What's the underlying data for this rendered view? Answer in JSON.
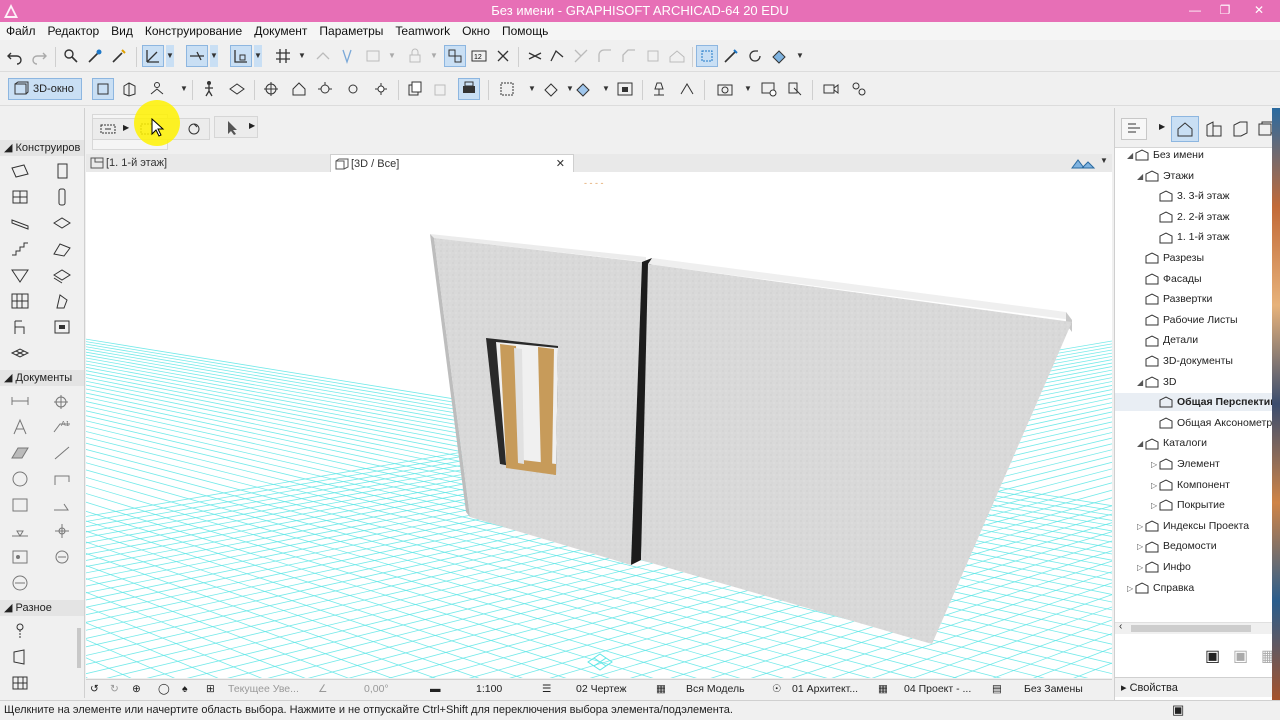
{
  "window": {
    "title": "Без имени - GRAPHISOFT ARCHICAD-64 20 EDU",
    "controls": [
      "minimize-icon",
      "restore-icon",
      "close-icon"
    ]
  },
  "menu": [
    "Файл",
    "Редактор",
    "Вид",
    "Конструирование",
    "Документ",
    "Параметры",
    "Teamwork",
    "Окно",
    "Помощь"
  ],
  "toolbar2": {
    "view_button_label": "3D-окно"
  },
  "toolbox": {
    "sections": [
      {
        "label": "Конструиров"
      },
      {
        "label": "Документы"
      },
      {
        "label": "Разное"
      }
    ]
  },
  "tabs": [
    {
      "label": "[1. 1-й этаж]"
    },
    {
      "label": "[3D / Все]"
    }
  ],
  "bottom_bar": {
    "undo_label": "Текущее Уве...",
    "angle": "0,00°",
    "scale": "1:100",
    "layer_combo": "02 Чертеж",
    "model": "Вся Модель",
    "pen_set": "01 Архитект...",
    "mvo": "04 Проект - ...",
    "renovation": "Без Замены"
  },
  "status_text": "Щелкните на элементе или начертите область выбора. Нажмите и не отпускайте Ctrl+Shift для переключения выбора элемента/подэлемента.",
  "navigator": {
    "tree": [
      {
        "label": "Без имени",
        "level": 0,
        "arrow": "down"
      },
      {
        "label": "Этажи",
        "level": 1,
        "arrow": "down"
      },
      {
        "label": "3. 3-й этаж",
        "level": 2
      },
      {
        "label": "2. 2-й этаж",
        "level": 2
      },
      {
        "label": "1. 1-й этаж",
        "level": 2
      },
      {
        "label": "Разрезы",
        "level": 1
      },
      {
        "label": "Фасады",
        "level": 1
      },
      {
        "label": "Развертки",
        "level": 1
      },
      {
        "label": "Рабочие Листы",
        "level": 1
      },
      {
        "label": "Детали",
        "level": 1
      },
      {
        "label": "3D-документы",
        "level": 1
      },
      {
        "label": "3D",
        "level": 1,
        "arrow": "down"
      },
      {
        "label": "Общая Перспектива",
        "level": 2,
        "selected": true
      },
      {
        "label": "Общая Аксонометрия",
        "level": 2
      },
      {
        "label": "Каталоги",
        "level": 1,
        "arrow": "down"
      },
      {
        "label": "Элемент",
        "level": 2,
        "arrow": "right"
      },
      {
        "label": "Компонент",
        "level": 2,
        "arrow": "right"
      },
      {
        "label": "Покрытие",
        "level": 2,
        "arrow": "right"
      },
      {
        "label": "Индексы Проекта",
        "level": 1,
        "arrow": "right"
      },
      {
        "label": "Ведомости",
        "level": 1,
        "arrow": "right"
      },
      {
        "label": "Инфо",
        "level": 1,
        "arrow": "right"
      },
      {
        "label": "Справка",
        "level": 0,
        "arrow": "right"
      }
    ],
    "properties_label": "Свойства"
  },
  "colors": {
    "titlebar": "#e76fb6",
    "grid": "#5ee6e6",
    "wall": "#d8d8d8",
    "highlight": "#fff200"
  }
}
